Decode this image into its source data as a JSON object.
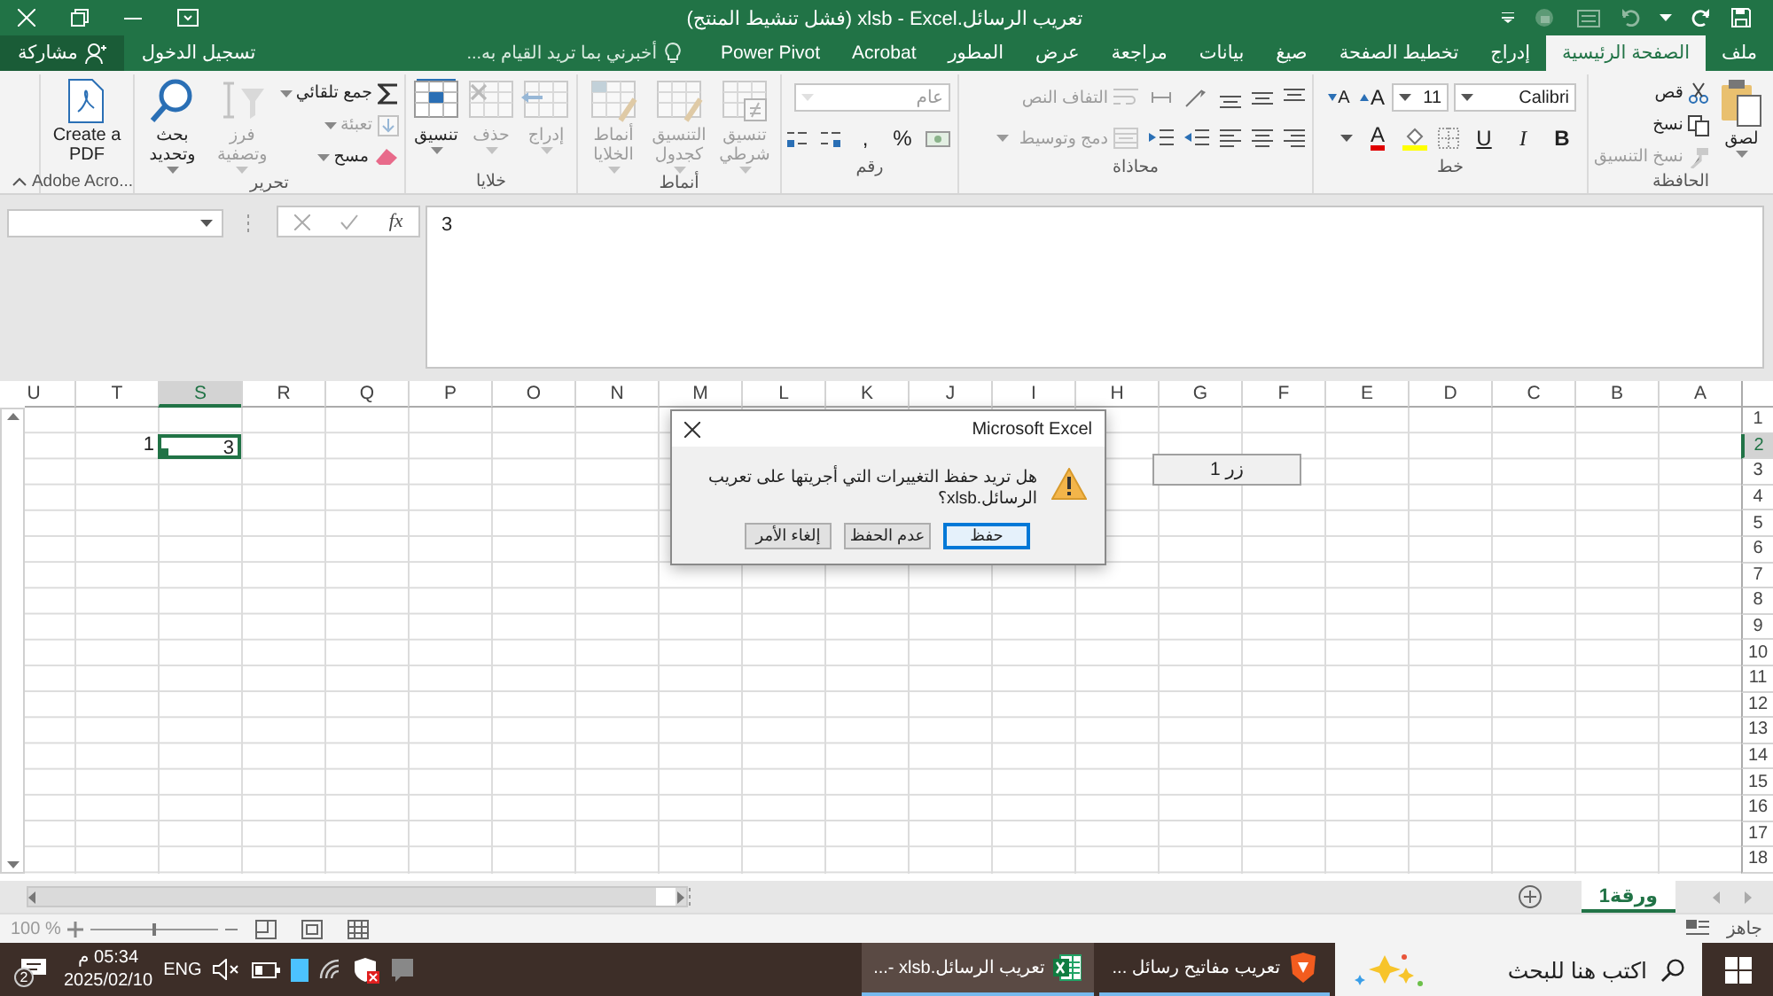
{
  "title_bar": {
    "title": "تعريب الرسائل.xlsb - Excel (فشل تنشيط المنتج)"
  },
  "tabs": [
    {
      "label": "ملف",
      "selected": false
    },
    {
      "label": "الصفحة الرئيسية",
      "selected": true
    },
    {
      "label": "إدراج",
      "selected": false
    },
    {
      "label": "تخطيط الصفحة",
      "selected": false
    },
    {
      "label": "صيغ",
      "selected": false
    },
    {
      "label": "بيانات",
      "selected": false
    },
    {
      "label": "مراجعة",
      "selected": false
    },
    {
      "label": "عرض",
      "selected": false
    },
    {
      "label": "المطور",
      "selected": false
    },
    {
      "label": "Acrobat",
      "selected": false
    },
    {
      "label": "Power Pivot",
      "selected": false
    }
  ],
  "tell_me": {
    "placeholder": "أخبرني بما تريد القيام به..."
  },
  "sign_in": "تسجيل الدخول",
  "share": "مشاركة",
  "ribbon": {
    "groups": [
      {
        "kind": "clipboard",
        "label": "الحافظة",
        "paste": "لصق",
        "items": [
          {
            "label": "قص",
            "disabled": false
          },
          {
            "label": "نسخ",
            "disabled": false
          },
          {
            "label": "نسخ التنسيق",
            "disabled": true
          }
        ]
      },
      {
        "kind": "font",
        "label": "خط",
        "font_name": "Calibri",
        "font_size": "11",
        "grow": "A",
        "shrink": "A",
        "styles": [
          "B",
          "I",
          "U"
        ],
        "font_color": "A"
      },
      {
        "kind": "alignment",
        "label": "محاذاة",
        "wrap": {
          "label": "التفاف النص",
          "disabled": true
        },
        "merge": {
          "label": "دمج وتوسيط",
          "disabled": true
        }
      },
      {
        "kind": "number",
        "label": "رقم",
        "format": {
          "value": "عام",
          "disabled": true
        },
        "percent": "%",
        "comma": ","
      },
      {
        "kind": "styles",
        "label": "أنماط",
        "items": [
          {
            "label": "تنسيق شرطي",
            "disabled": true
          },
          {
            "label": "التنسيق كجدول",
            "disabled": true
          },
          {
            "label": "أنماط الخلايا",
            "disabled": true
          }
        ]
      },
      {
        "kind": "cells",
        "label": "خلايا",
        "items": [
          {
            "label": "إدراج",
            "disabled": true
          },
          {
            "label": "حذف",
            "disabled": true
          },
          {
            "label": "تنسيق",
            "disabled": false
          }
        ]
      },
      {
        "kind": "editing",
        "label": "تحرير",
        "small": [
          {
            "label": "جمع تلقائي",
            "disabled": false
          },
          {
            "label": "تعبئة",
            "disabled": true
          },
          {
            "label": "مسح",
            "disabled": false
          }
        ],
        "large": [
          {
            "label": "فرز وتصفية",
            "disabled": true
          },
          {
            "label": "بحث وتحديد",
            "disabled": false
          }
        ]
      },
      {
        "kind": "adobe",
        "label": "Adobe Acro...",
        "button": "Create a PDF"
      }
    ]
  },
  "formula_bar": {
    "fx": "fx",
    "value": "3"
  },
  "sheet": {
    "columns": [
      {
        "label": "A",
        "selected": false
      },
      {
        "label": "B",
        "selected": false
      },
      {
        "label": "C",
        "selected": false
      },
      {
        "label": "D",
        "selected": false
      },
      {
        "label": "E",
        "selected": false
      },
      {
        "label": "F",
        "selected": false
      },
      {
        "label": "G",
        "selected": false
      },
      {
        "label": "H",
        "selected": false
      },
      {
        "label": "I",
        "selected": false
      },
      {
        "label": "J",
        "selected": false
      },
      {
        "label": "K",
        "selected": false
      },
      {
        "label": "L",
        "selected": false
      },
      {
        "label": "M",
        "selected": false
      },
      {
        "label": "N",
        "selected": false
      },
      {
        "label": "O",
        "selected": false
      },
      {
        "label": "P",
        "selected": false
      },
      {
        "label": "Q",
        "selected": false
      },
      {
        "label": "R",
        "selected": false
      },
      {
        "label": "S",
        "selected": true
      },
      {
        "label": "T",
        "selected": false
      },
      {
        "label": "U",
        "selected": false
      }
    ],
    "rows": [
      {
        "label": "1",
        "selected": false
      },
      {
        "label": "2",
        "selected": true,
        "cells": [
          null,
          null,
          null,
          null,
          null,
          null,
          null,
          null,
          null,
          null,
          null,
          null,
          null,
          null,
          null,
          null,
          null,
          null,
          {
            "value": "3",
            "selected": true
          },
          {
            "value": "1",
            "selected": false
          },
          null
        ]
      },
      {
        "label": "3",
        "selected": false
      },
      {
        "label": "4",
        "selected": false
      },
      {
        "label": "5",
        "selected": false
      },
      {
        "label": "6",
        "selected": false
      },
      {
        "label": "7",
        "selected": false
      },
      {
        "label": "8",
        "selected": false
      },
      {
        "label": "9",
        "selected": false
      },
      {
        "label": "10",
        "selected": false
      },
      {
        "label": "11",
        "selected": false
      },
      {
        "label": "12",
        "selected": false
      },
      {
        "label": "13",
        "selected": false
      },
      {
        "label": "14",
        "selected": false
      },
      {
        "label": "15",
        "selected": false
      },
      {
        "label": "16",
        "selected": false
      },
      {
        "label": "17",
        "selected": false
      },
      {
        "label": "18",
        "selected": false
      }
    ]
  },
  "form_button": {
    "label": "زر 1"
  },
  "dialog": {
    "title": "Microsoft Excel",
    "message": "هل تريد حفظ التغييرات التي أجريتها على تعريب الرسائل.xlsb؟",
    "buttons": [
      {
        "label": "حفظ",
        "selected": true
      },
      {
        "label": "عدم الحفظ",
        "selected": false
      },
      {
        "label": "إلغاء الأمر",
        "selected": false
      }
    ]
  },
  "sheet_tabs": [
    {
      "label": "ورقة1",
      "selected": true
    }
  ],
  "status_bar": {
    "status": "جاهز",
    "zoom": "100 %",
    "zoom_slider": {
      "level": 0.5
    }
  },
  "taskbar": {
    "search": {
      "placeholder": "اكتب هنا للبحث"
    },
    "apps": [
      {
        "kind": "browser",
        "label": "تعريب مفاتيح رسائل ...",
        "selected": false
      },
      {
        "kind": "excel",
        "label": "تعريب الرسائل.xlsb -...",
        "selected": true
      }
    ],
    "language": "ENG",
    "time": "05:34 م",
    "date": "2025/02/10",
    "notifications": "2"
  }
}
